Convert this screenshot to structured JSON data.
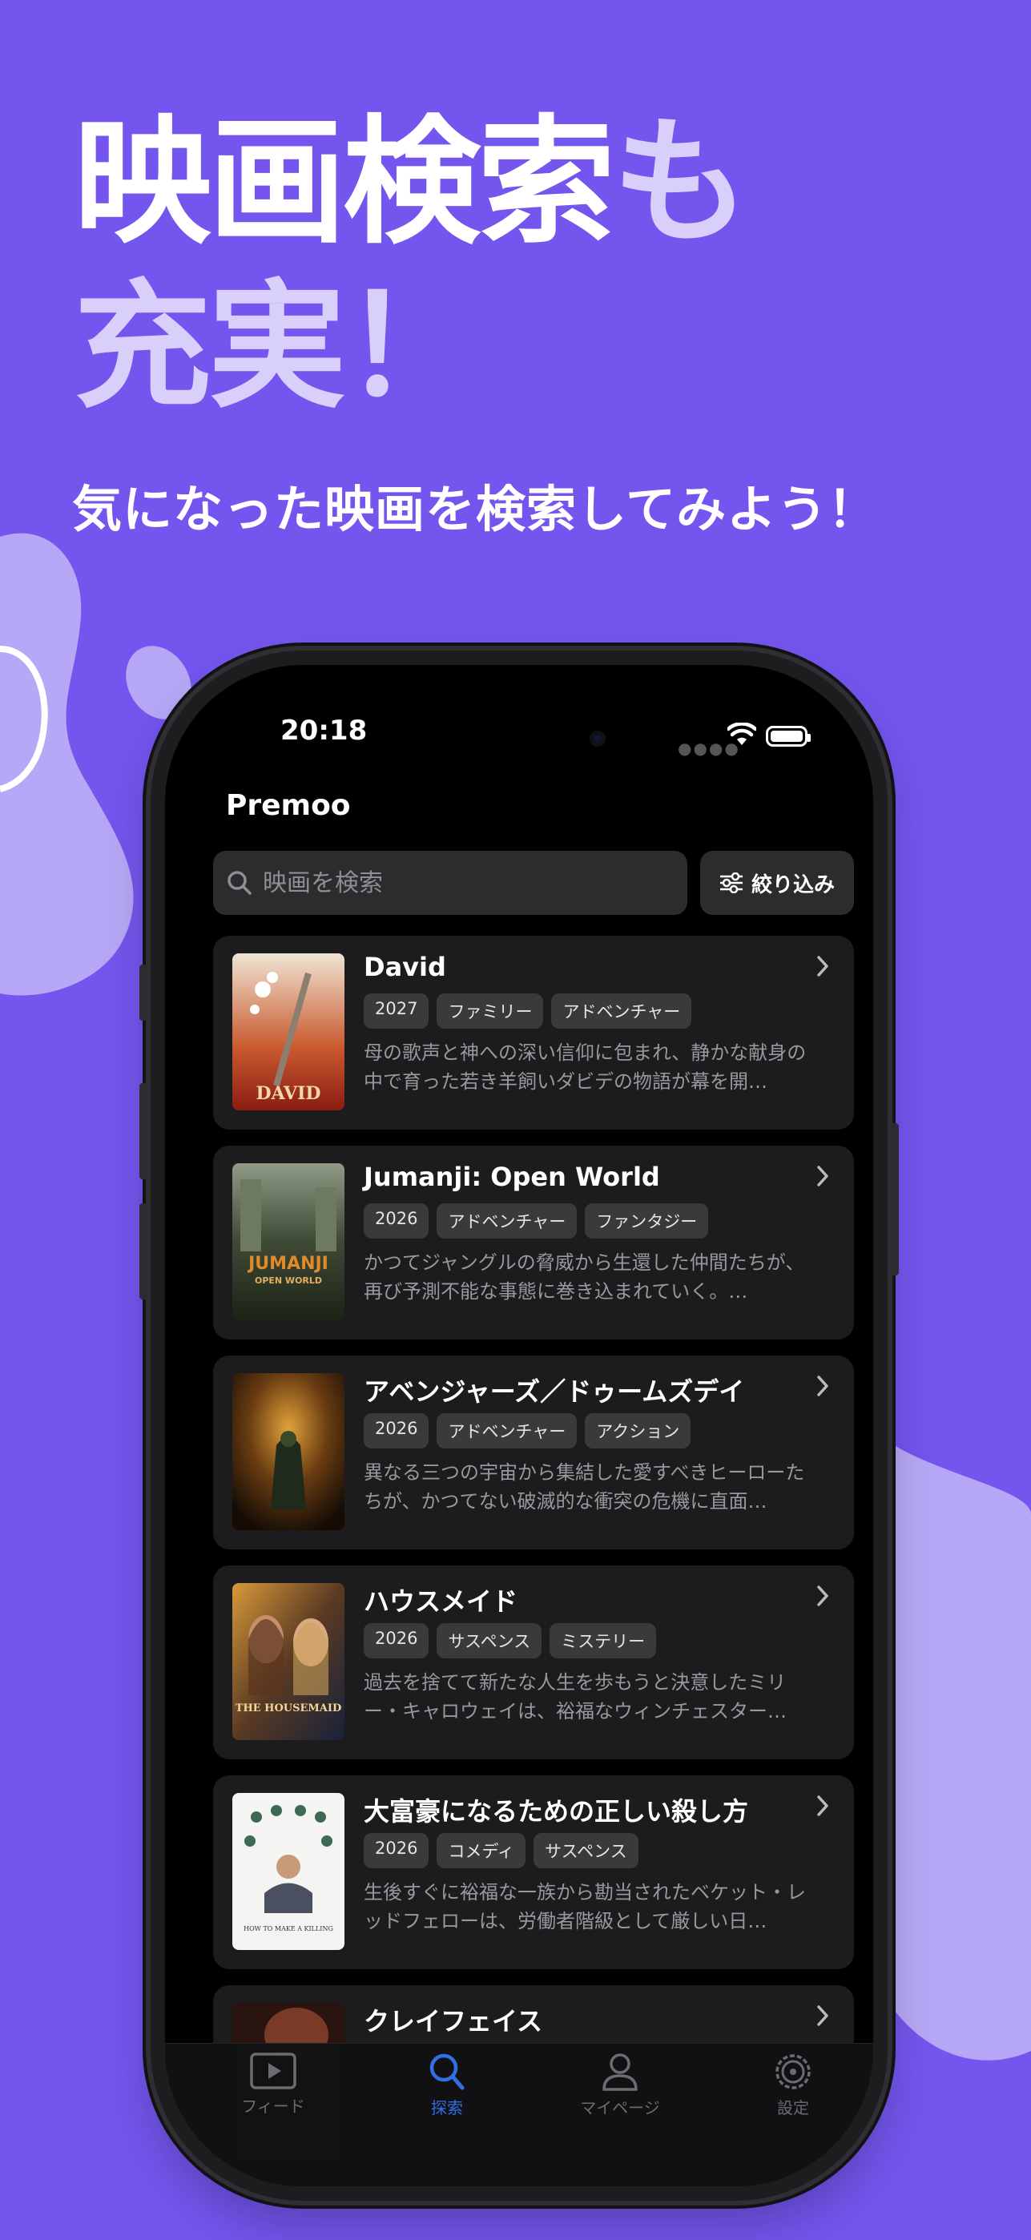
{
  "promo": {
    "headline_white": "映画検索",
    "headline_light_1": "も",
    "headline_light_2": "充実！",
    "subhead": "気になった映画を検索してみよう！"
  },
  "colors": {
    "background": "#7456ee",
    "blob": "#b7a8f7",
    "accent_active_tab": "#2f6fe8"
  },
  "status_bar": {
    "time": "20:18"
  },
  "app": {
    "title": "Premoo",
    "search_placeholder": "映画を検索",
    "filter_label": "絞り込み"
  },
  "movies": [
    {
      "title": "David",
      "year": "2027",
      "genres": [
        "ファミリー",
        "アドベンチャー"
      ],
      "description": "母の歌声と神への深い信仰に包まれ、静かな献身の中で育った若き羊飼いダビデの物語が幕を開…",
      "poster_label": "DAVID"
    },
    {
      "title": "Jumanji: Open World",
      "year": "2026",
      "genres": [
        "アドベンチャー",
        "ファンタジー"
      ],
      "description": "かつてジャングルの脅威から生還した仲間たちが、再び予測不能な事態に巻き込まれていく。…",
      "poster_label": "JUMANJI"
    },
    {
      "title": "アベンジャーズ／ドゥームズデイ",
      "year": "2026",
      "genres": [
        "アドベンチャー",
        "アクション"
      ],
      "description": "異なる三つの宇宙から集結した愛すべきヒーローたちが、かつてない破滅的な衝突の危機に直面…",
      "poster_label": ""
    },
    {
      "title": "ハウスメイド",
      "year": "2026",
      "genres": [
        "サスペンス",
        "ミステリー"
      ],
      "description": "過去を捨てて新たな人生を歩もうと決意したミリー・キャロウェイは、裕福なウィンチェスター…",
      "poster_label": "THE HOUSEMAID"
    },
    {
      "title": "大富豪になるための正しい殺し方",
      "year": "2026",
      "genres": [
        "コメディ",
        "サスペンス"
      ],
      "description": "生後すぐに裕福な一族から勘当されたベケット・レッドフェローは、労働者階級として厳しい日…",
      "poster_label": "HOW TO MAKE A KILLING"
    },
    {
      "title": "クレイフェイス",
      "year": "",
      "genres": [],
      "description": "",
      "poster_label": ""
    }
  ],
  "tabs": [
    {
      "label": "フィード",
      "icon": "play-icon",
      "active": false
    },
    {
      "label": "探索",
      "icon": "search-icon",
      "active": true
    },
    {
      "label": "マイページ",
      "icon": "person-icon",
      "active": false
    },
    {
      "label": "設定",
      "icon": "gear-icon",
      "active": false
    }
  ]
}
